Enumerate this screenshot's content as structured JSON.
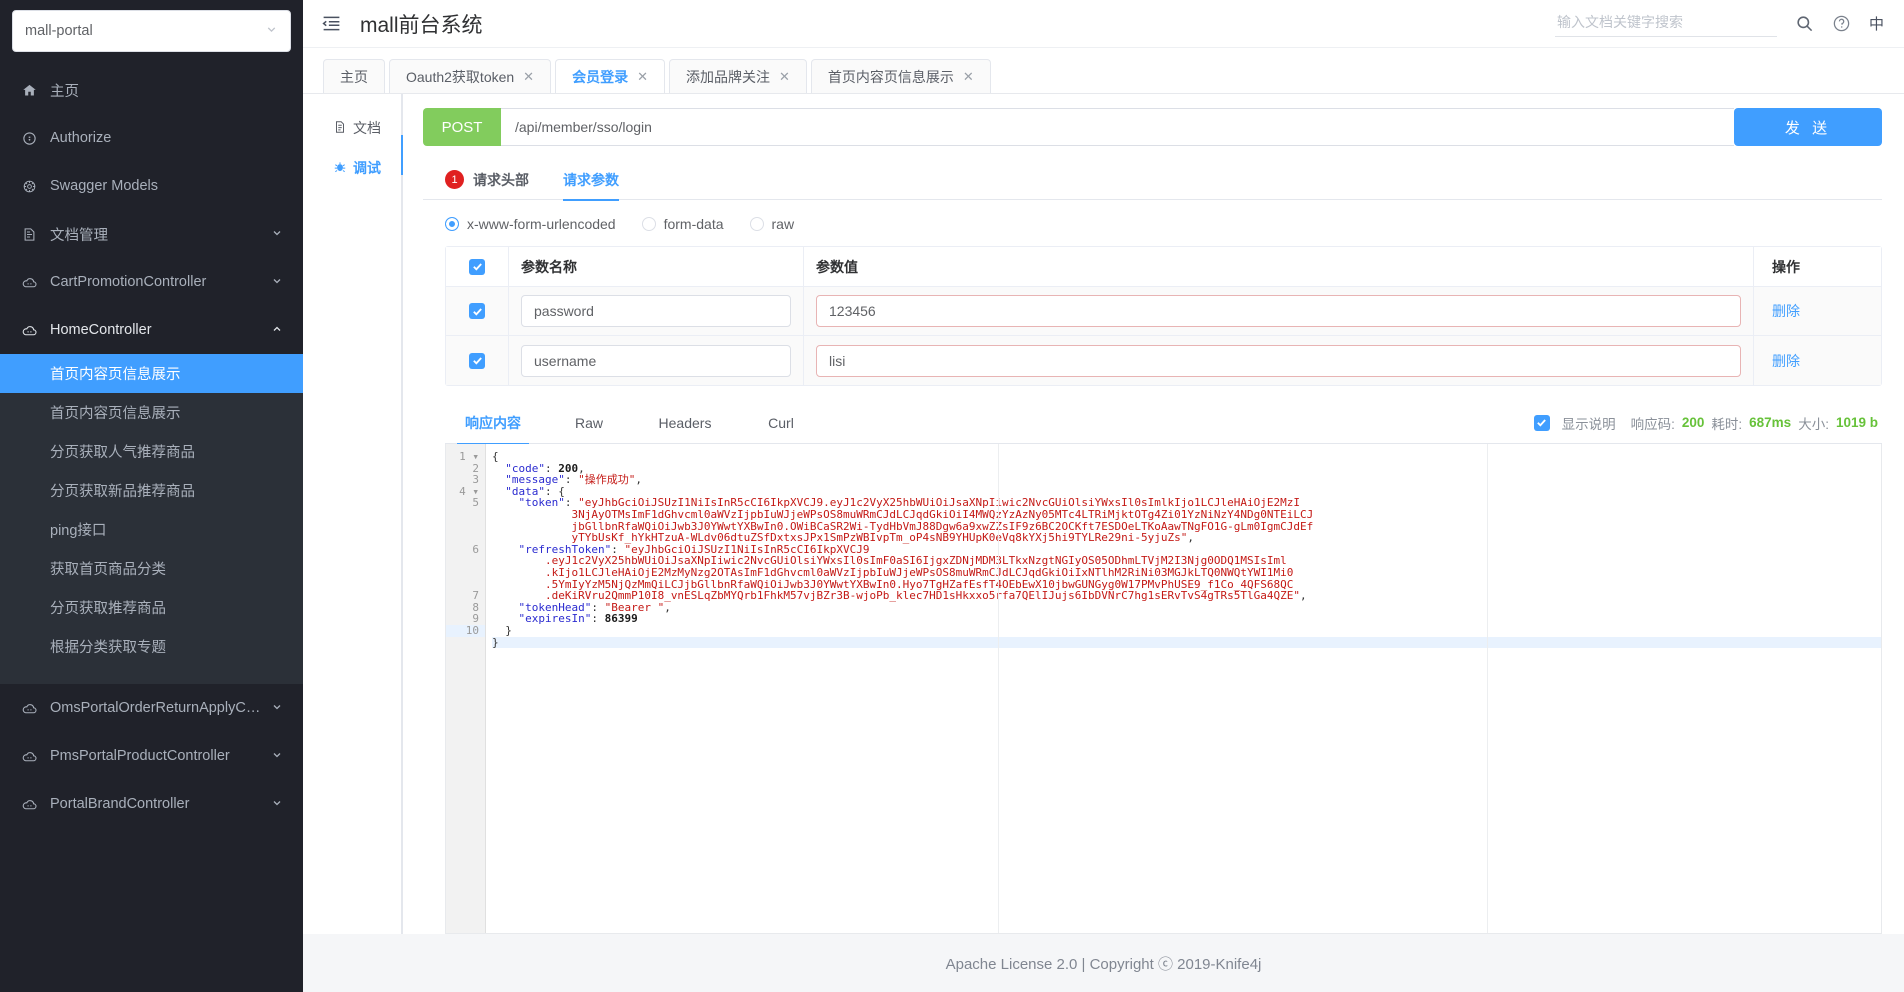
{
  "sidebar": {
    "service_select": {
      "value": "mall-portal",
      "caret": "chevron-down-icon"
    },
    "items": [
      {
        "label": "主页",
        "icon": "home-icon",
        "arrow": ""
      },
      {
        "label": "Authorize",
        "icon": "lock-icon",
        "arrow": ""
      },
      {
        "label": "Swagger Models",
        "icon": "models-icon",
        "arrow": ""
      },
      {
        "label": "文档管理",
        "icon": "doc-manage-icon",
        "arrow": "chevron-down-icon"
      },
      {
        "label": "CartPromotionController",
        "icon": "cloud-icon",
        "arrow": "chevron-down-icon"
      },
      {
        "label": "HomeController",
        "icon": "cloud-icon",
        "arrow": "chevron-up-icon"
      }
    ],
    "sub_items": [
      {
        "label": "首页内容页信息展示",
        "active": true
      },
      {
        "label": "首页内容页信息展示",
        "active": false
      },
      {
        "label": "分页获取人气推荐商品",
        "active": false
      },
      {
        "label": "分页获取新品推荐商品",
        "active": false
      },
      {
        "label": "ping接口",
        "active": false
      },
      {
        "label": "获取首页商品分类",
        "active": false
      },
      {
        "label": "分页获取推荐商品",
        "active": false
      },
      {
        "label": "根据分类获取专题",
        "active": false
      }
    ],
    "items_after": [
      {
        "label": "OmsPortalOrderReturnApplyCont…",
        "icon": "cloud-icon",
        "arrow": "chevron-down-icon"
      },
      {
        "label": "PmsPortalProductController",
        "icon": "cloud-icon",
        "arrow": "chevron-down-icon"
      },
      {
        "label": "PortalBrandController",
        "icon": "cloud-icon",
        "arrow": "chevron-down-icon"
      }
    ]
  },
  "topbar": {
    "collapse_icon": "menu-collapse-icon",
    "title": "mall前台系统",
    "search_placeholder": "输入文档关键字搜索",
    "search_value": "",
    "search_icon": "search-icon",
    "help_icon": "question-circle-icon",
    "lang": "中"
  },
  "tabs": [
    {
      "label": "主页",
      "closable": false,
      "active": false
    },
    {
      "label": "Oauth2获取token",
      "closable": true,
      "active": false
    },
    {
      "label": "会员登录",
      "closable": true,
      "active": true
    },
    {
      "label": "添加品牌关注",
      "closable": true,
      "active": false
    },
    {
      "label": "首页内容页信息展示",
      "closable": true,
      "active": false
    }
  ],
  "vtabs": [
    {
      "label": "文档",
      "icon": "document-icon",
      "active": false
    },
    {
      "label": "调试",
      "icon": "bug-icon",
      "active": true
    }
  ],
  "request": {
    "method": "POST",
    "url": "/api/member/sso/login",
    "send_label": "发 送",
    "tabs": [
      {
        "label": "请求头部",
        "badge": "1",
        "active": false
      },
      {
        "label": "请求参数",
        "badge": "",
        "active": true
      }
    ],
    "body_types": [
      {
        "label": "x-www-form-urlencoded",
        "selected": true
      },
      {
        "label": "form-data",
        "selected": false
      },
      {
        "label": "raw",
        "selected": false
      }
    ],
    "table": {
      "headers": {
        "name": "参数名称",
        "value": "参数值",
        "op": "操作"
      },
      "rows": [
        {
          "checked": true,
          "name": "password",
          "value": "123456",
          "op": "删除"
        },
        {
          "checked": true,
          "name": "username",
          "value": "lisi",
          "op": "删除"
        }
      ]
    }
  },
  "response": {
    "tabs": [
      {
        "label": "响应内容",
        "active": true
      },
      {
        "label": "Raw",
        "active": false
      },
      {
        "label": "Headers",
        "active": false
      },
      {
        "label": "Curl",
        "active": false
      }
    ],
    "show_desc_label": "显示说明",
    "show_desc_checked": true,
    "status_label": "响应码:",
    "status_value": "200",
    "time_label": "耗时:",
    "time_value": "687ms",
    "size_label": "大小:",
    "size_value": "1019 b",
    "line_numbers": [
      "1",
      "2",
      "3",
      "4",
      "5",
      "6",
      "7",
      "8",
      "9",
      "10"
    ],
    "json": {
      "code": 200,
      "message": "操作成功",
      "data": {
        "token": "eyJhbGciOiJSUzI1NiIsInR5cCI6IkpXVCJ9.eyJ1c2VyX25hbWUiOiJsaXNpIiwic2NvcGUiOlsiYWxsIl0sImlkIjo1LCJleHAiOjE2MzI3NjAyOTMsImF1dGhvcml0aWVzIjpbIuWJjeWPsOS8muWRmCJdLCJqdGkiOiI4MWQzYzAzNy05MTc4LTRiMjktOTg4Zi01YzNiNzY4NDg0NTEiLCJjbGllbnRfaWQiOiJwb3J0YWwtYXBwIn0.OWiBCaSR2Wi-TydHbVmJ88Dgw6a9xwZZsIF9z6BC2OCKft7ESDOeLTKoAawTNgFO1G-gLm0IgmCJdEfyTYbUsKf_hYkHTzuA-WLdv06dtuZSfDxtxsJPx1SmPzWBIvpTm_oP4sNB9YHUpK0eVq8kYXj5hi9TYLRe29ni-5yjuZs",
        "refreshToken": "eyJhbGciOiJSUzI1NiIsInR5cCI6IkpXVCJ9.eyJ1c2VyX25hbWUiOiJsaXNpIiwic2NvcGUiOlsiYWxsIl0sImF0aSI6IjgxZDNjMDM3LTkxNzgtNGIyOS05ODhmLTVjM2I3Njg0ODQ1MSIsImlkIjo1LCJleHAiOjE2MzMyNzg2OTAsImF1dGhvcml0aWVzIjpbIuWJjeWPsOS8muWRmCJdLCJqdGkiOiIxNTlhM2RiNi03MGJkLTQ0NWQtYWI1Mi05YmIyYzM5NjQzMmQiLCJjbGllbnRfaWQiOiJwb3J0YWwtYXBwIn0.Hyo7TgHZafEsfT4OEbEwX10jbwGUNGyg0W17PMvPhUSE9_f1Co_4QFS68QCdeKiRVru2QmmP10I8_vnESLqZbMYQrb1FhkM57vjBZr3B-wjoPb_klec7HD1sHkxxo5rfa7QElIJujs6IbDVNrC7hg1sERvTvS4gTRs5TlGa4QZE",
        "tokenHead": "Bearer ",
        "expiresIn": 86399
      }
    }
  },
  "footer": {
    "text": "Apache License 2.0 | Copyright ⓒ 2019-Knife4j"
  }
}
